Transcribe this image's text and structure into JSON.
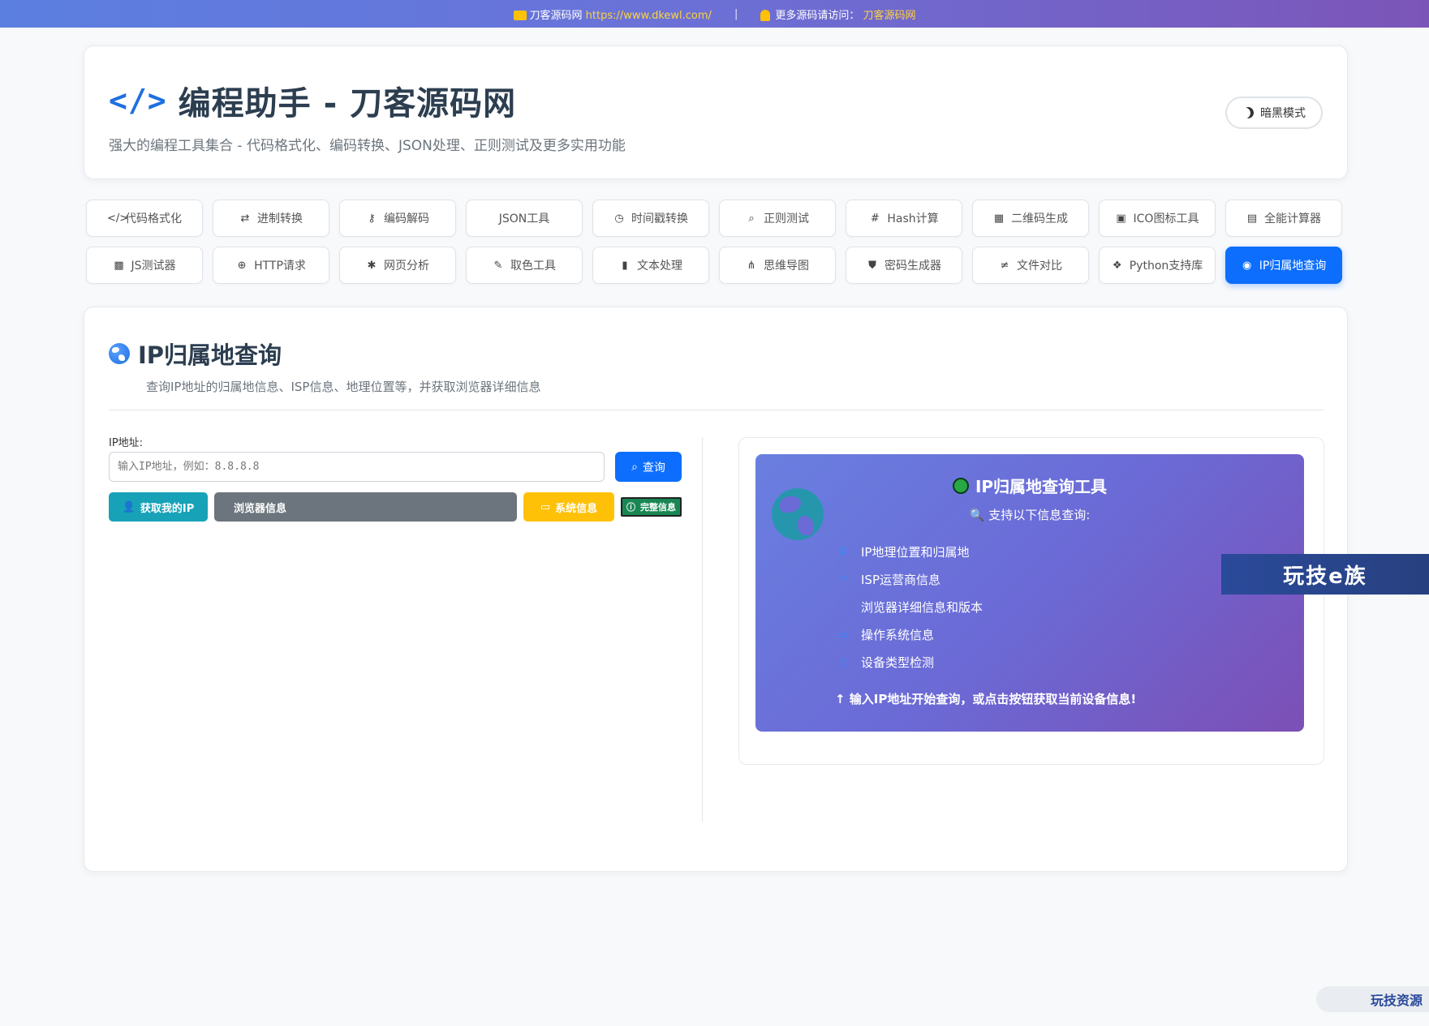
{
  "topbar": {
    "site_name": "刀客源码网",
    "url": "https://www.dkewl.com/",
    "separator": "|",
    "more_label": "更多源码请访问：",
    "more_link": "刀客源码网"
  },
  "header": {
    "icon": "</>",
    "title": "编程助手 - 刀客源码网",
    "subtitle": "强大的编程工具集合 - 代码格式化、编码转换、JSON处理、正则测试及更多实用功能",
    "dark_mode_label": "暗黑模式"
  },
  "tools_row1": [
    {
      "icon": "</>",
      "label": "代码格式化"
    },
    {
      "icon": "⇄",
      "label": "进制转换"
    },
    {
      "icon": "⚷",
      "label": "编码解码"
    },
    {
      "icon": "",
      "label": "JSON工具"
    },
    {
      "icon": "◷",
      "label": "时间戳转换"
    },
    {
      "icon": "⌕",
      "label": "正则测试"
    },
    {
      "icon": "#",
      "label": "Hash计算"
    },
    {
      "icon": "▦",
      "label": "二维码生成"
    },
    {
      "icon": "▣",
      "label": "ICO图标工具"
    },
    {
      "icon": "▤",
      "label": "全能计算器"
    }
  ],
  "tools_row2": [
    {
      "icon": "▩",
      "label": "JS测试器"
    },
    {
      "icon": "⊕",
      "label": "HTTP请求"
    },
    {
      "icon": "✱",
      "label": "网页分析"
    },
    {
      "icon": "✎",
      "label": "取色工具"
    },
    {
      "icon": "▮",
      "label": "文本处理"
    },
    {
      "icon": "⋔",
      "label": "思维导图"
    },
    {
      "icon": "⛊",
      "label": "密码生成器"
    },
    {
      "icon": "≠",
      "label": "文件对比"
    },
    {
      "icon": "❖",
      "label": "Python支持库"
    },
    {
      "icon": "◉",
      "label": "IP归属地查询"
    }
  ],
  "main": {
    "title": "IP归属地查询",
    "subtitle": "查询IP地址的归属地信息、ISP信息、地理位置等，并获取浏览器详细信息",
    "ip_label": "IP地址:",
    "ip_placeholder": "输入IP地址，例如：8.8.8.8",
    "query_label": "查询",
    "btn_my_ip": "获取我的IP",
    "btn_browser": "浏览器信息",
    "btn_system": "系统信息",
    "btn_full": "完整信息"
  },
  "info_panel": {
    "title": "IP归属地查询工具",
    "subtitle": "支持以下信息查询:",
    "features": [
      {
        "icon": "⚲",
        "label": "IP地理位置和归属地"
      },
      {
        "icon": "◠",
        "label": "ISP运营商信息"
      },
      {
        "icon": "",
        "label": "浏览器详细信息和版本"
      },
      {
        "icon": "▭",
        "label": "操作系统信息"
      },
      {
        "icon": "▯",
        "label": "设备类型检测"
      }
    ],
    "footer": "↑ 输入IP地址开始查询，或点击按钮获取当前设备信息!"
  },
  "watermarks": {
    "banner": "玩技e族",
    "bottom": "玩技资源"
  },
  "colors": {
    "primary": "#0d6efd",
    "info": "#17a2b8",
    "secondary": "#6c757d",
    "warning": "#ffc107",
    "success": "#198754"
  }
}
